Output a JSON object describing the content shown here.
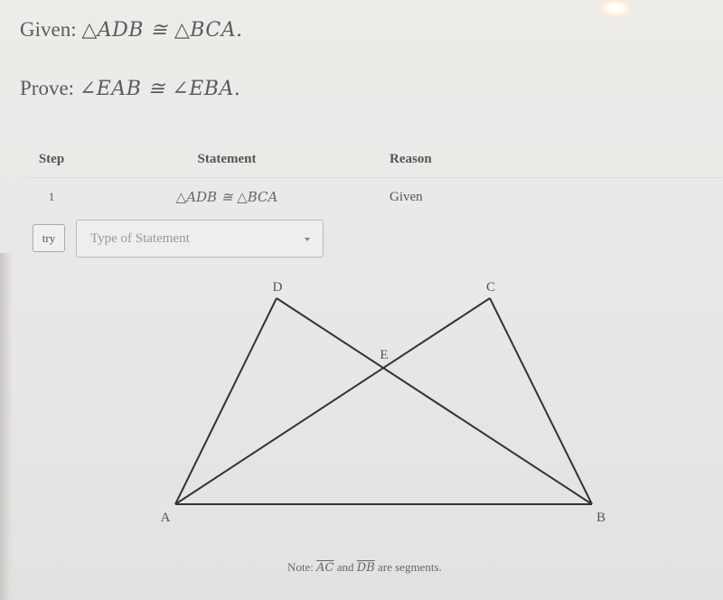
{
  "problem": {
    "given_label": "Given:",
    "given_math": "△ADB ≅  △BCA.",
    "prove_label": "Prove:",
    "prove_math": "∠EAB ≅  ∠EBA."
  },
  "proof_table": {
    "headers": {
      "step": "Step",
      "statement": "Statement",
      "reason": "Reason"
    },
    "rows": [
      {
        "step": "1",
        "statement": "△ADB ≅ △BCA",
        "reason": "Given"
      }
    ]
  },
  "input_row": {
    "try_label": "try",
    "statement_placeholder": "Type of Statement",
    "caret_icon": "chevron-down-icon"
  },
  "figure": {
    "points": [
      {
        "name": "A",
        "label": "A"
      },
      {
        "name": "B",
        "label": "B"
      },
      {
        "name": "C",
        "label": "C"
      },
      {
        "name": "D",
        "label": "D"
      },
      {
        "name": "E",
        "label": "E"
      }
    ],
    "segments": [
      [
        "A",
        "B"
      ],
      [
        "A",
        "D"
      ],
      [
        "B",
        "C"
      ],
      [
        "A",
        "C"
      ],
      [
        "D",
        "B"
      ]
    ],
    "stroke_color": "#333333"
  },
  "note": {
    "prefix": "Note:",
    "seg1": "AC",
    "mid": "and",
    "seg2": "DB",
    "suffix": "are segments."
  }
}
